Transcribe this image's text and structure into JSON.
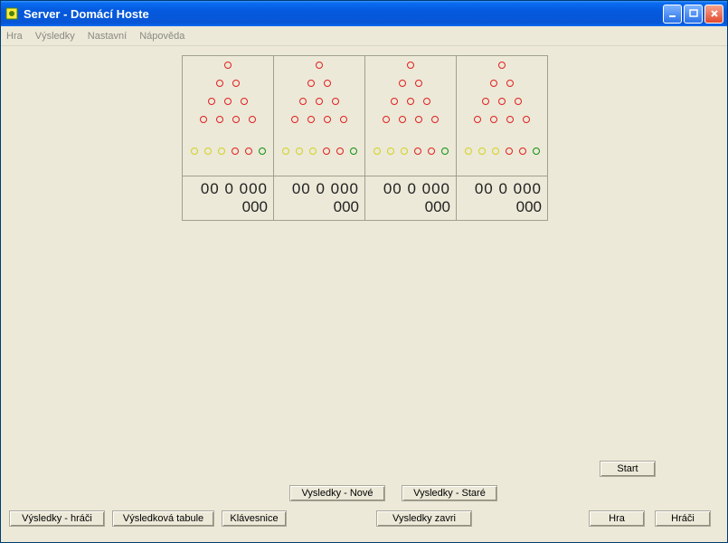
{
  "title": "Server - Domácí Hoste",
  "menu": {
    "hra": "Hra",
    "vysledky": "Výsledky",
    "nastavni": "Nastavní",
    "napoveda": "Nápověda"
  },
  "lanes": [
    {
      "score_line1": "00  0  000",
      "score_line2": "000"
    },
    {
      "score_line1": "00  0  000",
      "score_line2": "000"
    },
    {
      "score_line1": "00  0  000",
      "score_line2": "000"
    },
    {
      "score_line1": "00  0  000",
      "score_line2": "000"
    }
  ],
  "buttons": {
    "start": "Start",
    "vysledky_nove": "Vysledky - Nové",
    "vysledky_stare": "Vysledky - Staré",
    "vysledky_hraci": "Výsledky - hráči",
    "vysledkova_tabule": "Výsledková tabule",
    "klavesnice": "Klávesnice",
    "vysledky_zavri": "Vysledky zavri",
    "hra": "Hra",
    "hraci": "Hráči"
  },
  "pins": {
    "triangle_rows": [
      1,
      2,
      3,
      4
    ],
    "bottom": [
      "yellow",
      "yellow",
      "yellow",
      "red",
      "red",
      "green"
    ]
  },
  "colors": {
    "red": "#e02020",
    "yellow": "#d2d220",
    "green": "#109010",
    "accent": "#0a6cf0"
  }
}
